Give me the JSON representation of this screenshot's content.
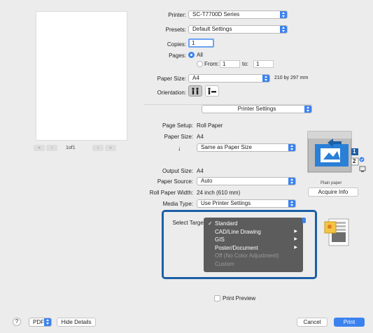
{
  "preview": {
    "page_indicator": "1of1",
    "nav_first": "«",
    "nav_prev": "‹",
    "nav_next": "›",
    "nav_last": "»"
  },
  "form": {
    "printer_label": "Printer:",
    "printer_value": "SC-T7700D Series",
    "presets_label": "Presets:",
    "presets_value": "Default Settings",
    "copies_label": "Copies:",
    "copies_value": "1",
    "pages_label": "Pages:",
    "pages_all": "All",
    "pages_from": "From:",
    "pages_from_value": "1",
    "pages_to": "to:",
    "pages_to_value": "1",
    "paper_size_label": "Paper Size:",
    "paper_size_value": "A4",
    "paper_size_dims": "210 by 297 mm",
    "orientation_label": "Orientation:",
    "section_popup": "Printer Settings"
  },
  "settings": {
    "page_setup_label": "Page Setup:",
    "page_setup_value": "Roll Paper",
    "paper_size_label": "Paper Size:",
    "paper_size_value": "A4",
    "arrow": "↓",
    "same_as_value": "Same as Paper Size",
    "output_size_label": "Output Size:",
    "output_size_value": "A4",
    "paper_source_label": "Paper Source:",
    "paper_source_value": "Auto",
    "roll_width_label": "Roll Paper Width:",
    "roll_width_value": "24 inch (610 mm)",
    "media_type_label": "Media Type:",
    "media_type_value": "Use Printer Settings",
    "printer_paper_caption": "Plain paper",
    "acquire_info_label": "Acquire Info",
    "badge_1": "1",
    "badge_2": "2"
  },
  "select_target": {
    "label": "Select Target",
    "checkmark": "✓",
    "items": [
      {
        "label": "Standard",
        "submenu": false,
        "enabled": true,
        "checked": true
      },
      {
        "label": "CAD/Line Drawing",
        "submenu": true,
        "enabled": true,
        "checked": false
      },
      {
        "label": "GIS",
        "submenu": true,
        "enabled": true,
        "checked": false
      },
      {
        "label": "Poster/Document",
        "submenu": true,
        "enabled": true,
        "checked": false
      },
      {
        "label": "Off (No Color Adjustment)",
        "submenu": false,
        "enabled": false,
        "checked": false
      },
      {
        "label": "Custom",
        "submenu": false,
        "enabled": false,
        "checked": false
      }
    ],
    "submenu_arrow": "▶"
  },
  "bottom": {
    "print_preview_label": "Print Preview",
    "help_label": "?",
    "pdf_label": "PDF",
    "hide_details_label": "Hide Details",
    "cancel_label": "Cancel",
    "print_label": "Print"
  },
  "colors": {
    "accent": "#3b82f0",
    "highlight_box": "#1b5fa6",
    "menu_bg": "#5c5c5c"
  }
}
